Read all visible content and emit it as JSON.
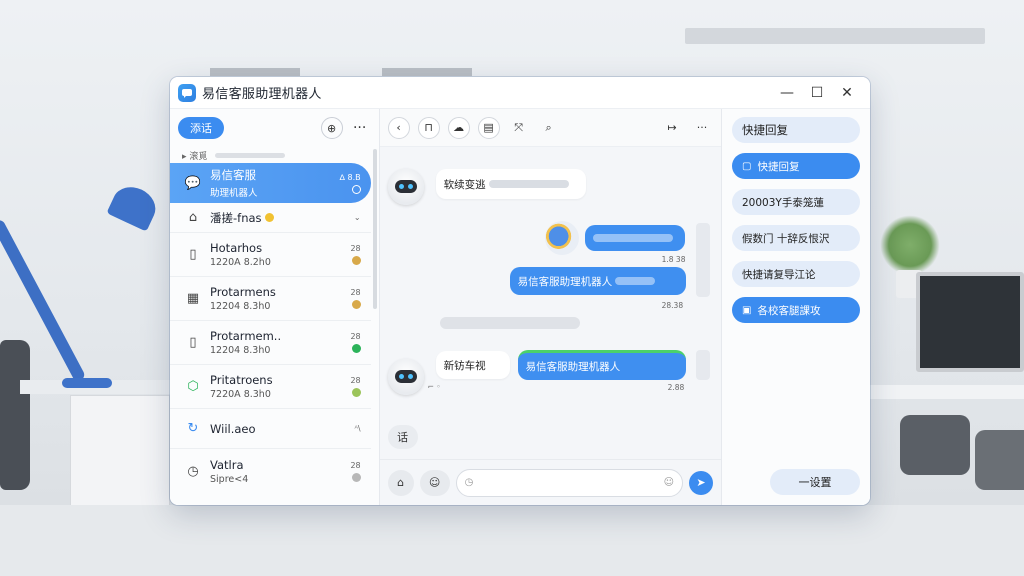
{
  "app": {
    "title": "易信客服助理机器人",
    "controls": {
      "minimize": "—",
      "maximize": "☐",
      "close": "✕"
    }
  },
  "sidebar": {
    "new_chat_label": "添话",
    "group_label": "▸ 滚覓",
    "conversations": [
      {
        "name": "易信客服",
        "sub": "助理机器人",
        "meta_top": "ᐃ 8.B",
        "active": true
      },
      {
        "name": "潘搓-fnas",
        "sub": "",
        "meta_top": "",
        "emoji": "😊"
      },
      {
        "name": "Hotarhos",
        "sub": "1220A 8.2h0",
        "meta_top": "28"
      },
      {
        "name": "Protarmens",
        "sub": "12204 8.3h0",
        "meta_top": "28"
      },
      {
        "name": "Protarmem..",
        "sub": "12204 8.3h0",
        "meta_top": "28"
      },
      {
        "name": "Pritatroens",
        "sub": "7220A 8.3h0",
        "meta_top": "28"
      },
      {
        "name": "Wiil.aeo",
        "sub": "",
        "meta_top": "ᴬ\\"
      },
      {
        "name": "Vatlra",
        "sub": "Sipre<4",
        "meta_top": "28"
      }
    ]
  },
  "chat": {
    "incoming_1": "软续变逃",
    "outgoing_1_time": "1.8 38",
    "outgoing_2": "易信客服助理机器人",
    "outgoing_2_time": "28.38",
    "incoming_2_label": "新钫车视",
    "outgoing_3": "易信客服助理机器人",
    "outgoing_3_time": "2.88",
    "quick_label": "话",
    "input_placeholder": ""
  },
  "quick_replies": {
    "title": "快捷回复",
    "items": [
      {
        "label": "快捷回复",
        "style": "blue",
        "icon": "▢"
      },
      {
        "label": "20003Y手泰笼蓮",
        "style": "light"
      },
      {
        "label": "假数门 十辞反恨沢",
        "style": "light"
      },
      {
        "label": "快捷请复导江论",
        "style": "light"
      },
      {
        "label": "各校客腿課攻",
        "style": "blue",
        "icon": "▣"
      }
    ],
    "bottom_label": "一设置"
  },
  "colors": {
    "accent": "#3b8cf0",
    "panel_light": "#e3ecf9"
  }
}
